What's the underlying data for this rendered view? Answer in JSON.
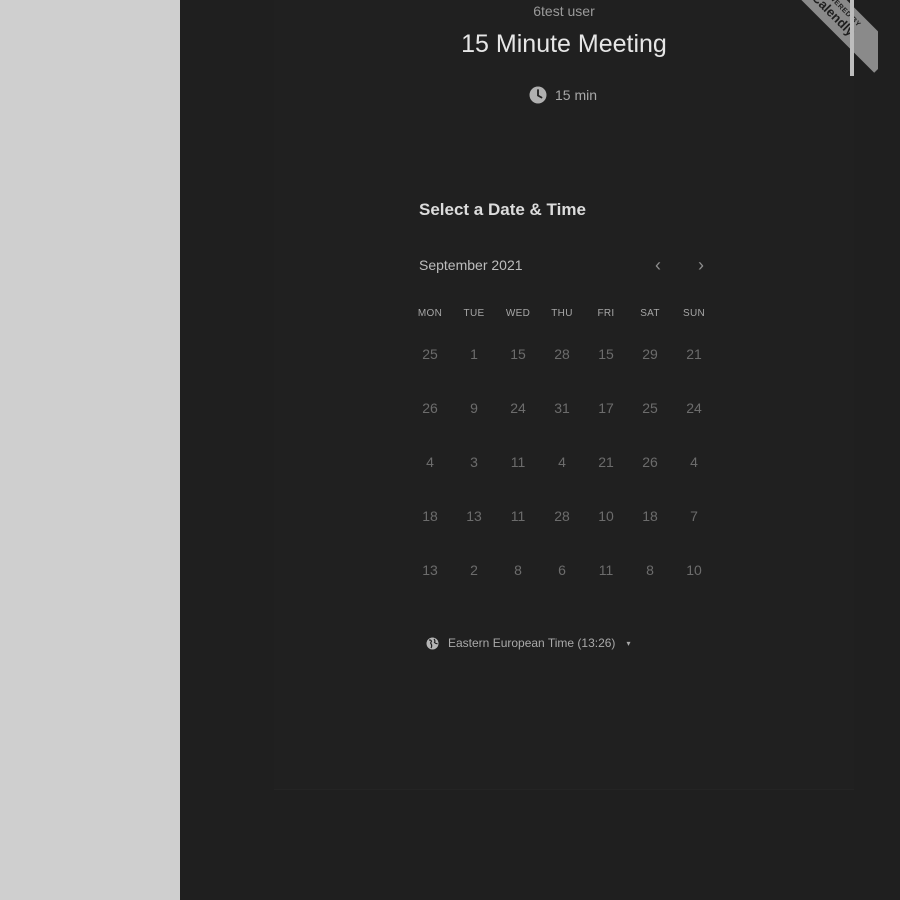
{
  "host": {
    "name": "6test user"
  },
  "event": {
    "title": "15 Minute Meeting",
    "duration": "15 min"
  },
  "badge": {
    "top": "POWERED BY",
    "brand": "Calendly"
  },
  "picker": {
    "heading": "Select a Date & Time",
    "month": "September 2021",
    "prev_icon": "‹",
    "next_icon": "›",
    "weekdays": [
      "MON",
      "TUE",
      "WED",
      "THU",
      "FRI",
      "SAT",
      "SUN"
    ],
    "weeks": [
      [
        "25",
        "1",
        "15",
        "28",
        "15",
        "29",
        "21"
      ],
      [
        "26",
        "9",
        "24",
        "31",
        "17",
        "25",
        "24"
      ],
      [
        "4",
        "3",
        "11",
        "4",
        "21",
        "26",
        "4"
      ],
      [
        "18",
        "13",
        "11",
        "28",
        "10",
        "18",
        "7"
      ],
      [
        "13",
        "2",
        "8",
        "6",
        "11",
        "8",
        "10"
      ]
    ]
  },
  "timezone": {
    "label": "Eastern European Time (13:26)",
    "caret": "▾"
  },
  "icons": {
    "duration": "clock-icon",
    "timezone": "globe-icon"
  },
  "colors": {
    "panel": "#1f1f1f",
    "gutter": "#cfcfcf",
    "ribbon": "#8a8a8a"
  }
}
